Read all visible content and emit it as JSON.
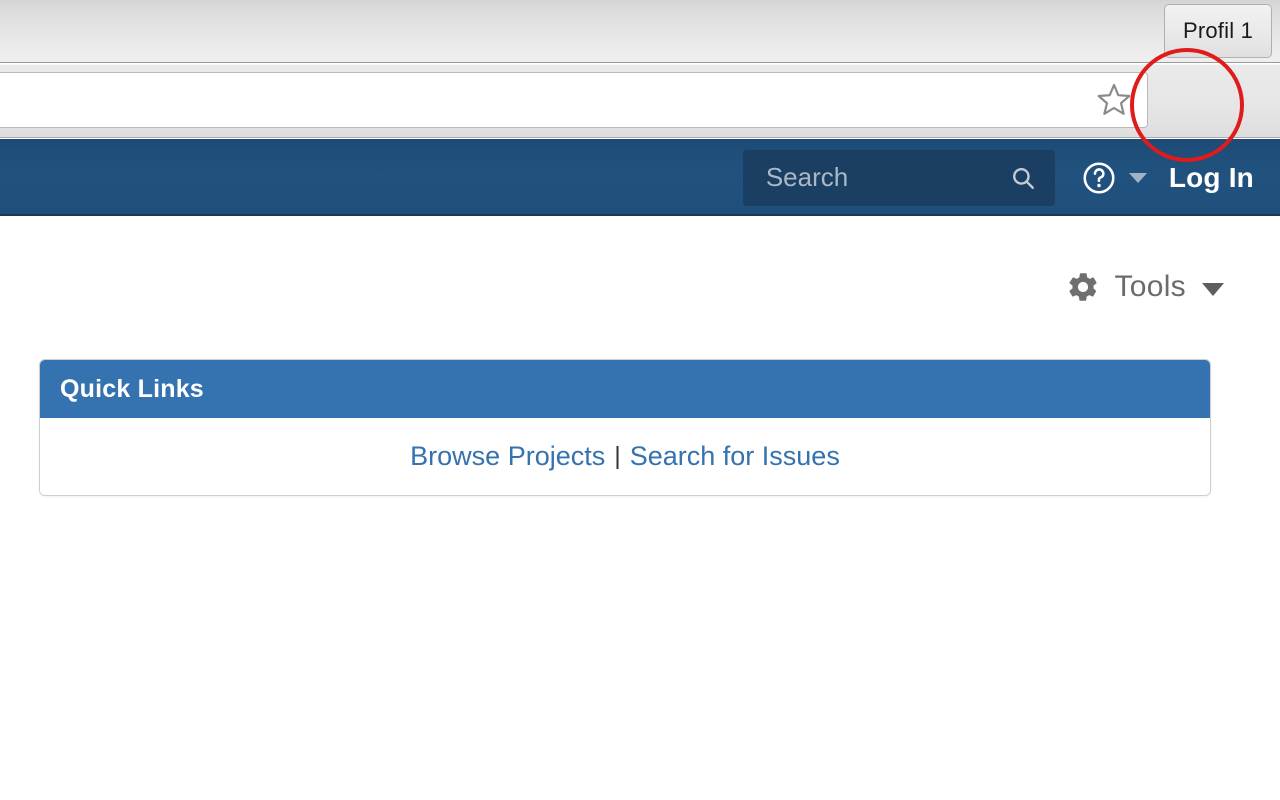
{
  "browser": {
    "profile_button_label": "Profil 1",
    "bookmark_icon": "star-icon",
    "extension_icon": "jira-extension-icon",
    "menu_icon": "hamburger-menu-icon",
    "url_value": "",
    "url_placeholder": ""
  },
  "annotation": {
    "shape": "circle",
    "color": "#e01b1b",
    "target": "jira-extension-icon"
  },
  "jira_header": {
    "search": {
      "placeholder": "Search",
      "value": "",
      "icon": "magnifier-icon"
    },
    "help": {
      "icon": "question-mark-circle-icon",
      "caret": "chevron-down-icon"
    },
    "login_label": "Log In",
    "background_color": "#1f4e79",
    "search_background_color": "#1a3f63"
  },
  "page": {
    "tools": {
      "icon": "gear-icon",
      "label": "Tools",
      "caret": "chevron-down-icon"
    },
    "quick_links": {
      "title": "Quick Links",
      "header_color": "#3572b0",
      "link_color": "#3572b0",
      "links": [
        {
          "label": "Browse Projects"
        },
        {
          "label": "Search for Issues"
        }
      ],
      "separator": "|"
    }
  }
}
